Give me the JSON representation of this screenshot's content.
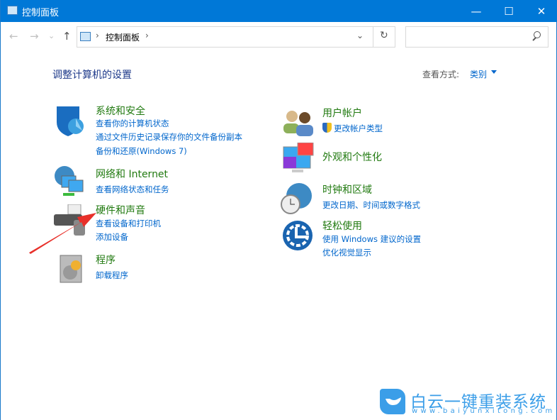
{
  "window": {
    "title": "控制面板",
    "minimize": "—",
    "maximize": "☐",
    "close": "✕"
  },
  "nav": {
    "back": "←",
    "forward": "→",
    "recent": "⌄",
    "up": "↑"
  },
  "address": {
    "path": "控制面板",
    "sep": "›",
    "dropdown": "⌄",
    "refresh": "↻"
  },
  "search": {
    "placeholder": "",
    "icon": "search-icon"
  },
  "heading": "调整计算机的设置",
  "view": {
    "label": "查看方式:",
    "value": "类别"
  },
  "categories": [
    {
      "title": "系统和安全",
      "links": [
        "查看你的计算机状态",
        "通过文件历史记录保存你的文件备份副本",
        "备份和还原(Windows 7)"
      ]
    },
    {
      "title": "网络和 Internet",
      "links": [
        "查看网络状态和任务"
      ]
    },
    {
      "title": "硬件和声音",
      "links": [
        "查看设备和打印机",
        "添加设备"
      ]
    },
    {
      "title": "程序",
      "links": [
        "卸载程序"
      ]
    },
    {
      "title": "用户帐户",
      "links": [
        "更改帐户类型"
      ]
    },
    {
      "title": "外观和个性化",
      "links": []
    },
    {
      "title": "时钟和区域",
      "links": [
        "更改日期、时间或数字格式"
      ]
    },
    {
      "title": "轻松使用",
      "links": [
        "使用 Windows 建议的设置",
        "优化视觉显示"
      ]
    }
  ],
  "watermark": {
    "name": "白云一键重装系统",
    "url": "www.baiyunxitong.com"
  },
  "colors": {
    "titlebar": "#0078d7",
    "category": "#217a10",
    "link": "#0066cc",
    "arrow": "#e8302a"
  }
}
